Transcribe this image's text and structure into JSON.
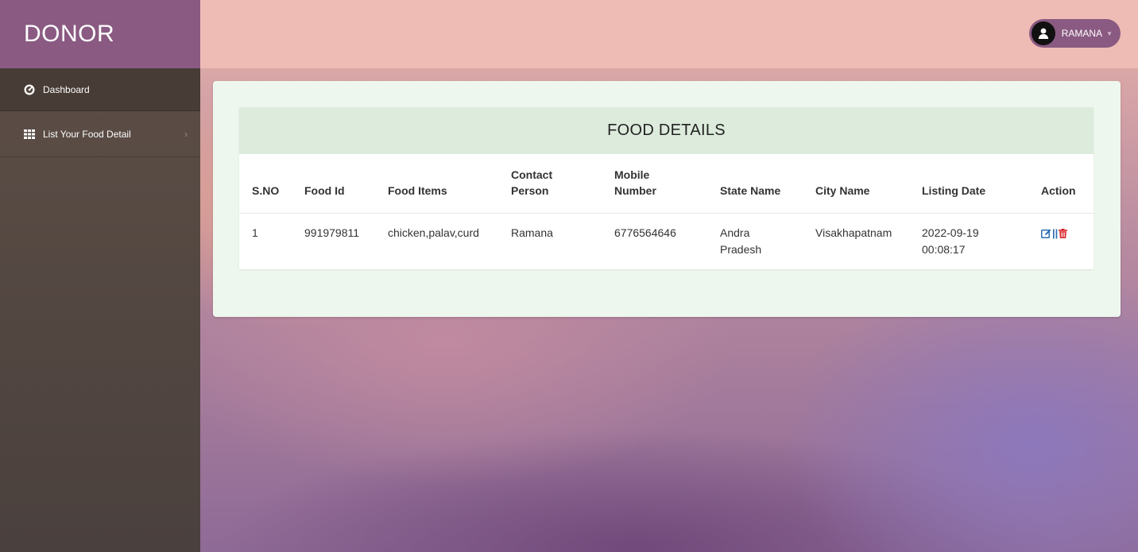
{
  "brand": "DONOR",
  "sidebar": {
    "items": [
      {
        "label": "Dashboard",
        "icon": "dashboard-icon"
      },
      {
        "label": "List Your Food Detail",
        "icon": "grid-icon"
      }
    ]
  },
  "header": {
    "user_name": "RAMANA"
  },
  "panel": {
    "title": "FOOD DETAILS",
    "columns": [
      "S.NO",
      "Food Id",
      "Food Items",
      "Contact Person",
      "Mobile Number",
      "State Name",
      "City Name",
      "Listing Date",
      "Action"
    ],
    "rows": [
      {
        "sno": "1",
        "food_id": "991979811",
        "food_items": "chicken,palav,curd",
        "contact_person": "Ramana",
        "mobile_number": "6776564646",
        "state_name": "Andra Pradesh",
        "city_name": "Visakhapatnam",
        "listing_date": "2022-09-19 00:08:17",
        "action_separator": "||"
      }
    ]
  },
  "colors": {
    "brand_bg": "#8a5a82",
    "topbar_bg": "#efbcb5",
    "panel_heading_bg": "#dcebdc",
    "edit_icon": "#2a6db0",
    "delete_icon": "#d9232d"
  }
}
